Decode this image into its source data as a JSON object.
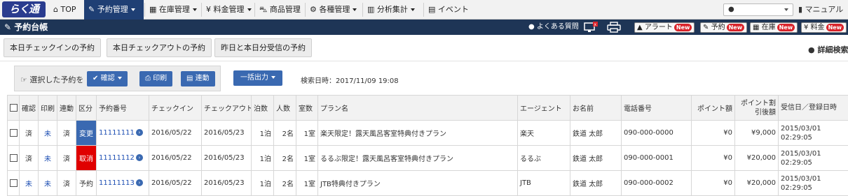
{
  "logo": "らく通",
  "nav": {
    "items": [
      {
        "icon": "home-icon",
        "label": "TOP"
      },
      {
        "icon": "edit-icon",
        "label": "予約管理"
      },
      {
        "icon": "grid-icon",
        "label": "在庫管理"
      },
      {
        "icon": "yen-icon",
        "label": "料金管理"
      },
      {
        "icon": "car-icon",
        "label": "商品管理"
      },
      {
        "icon": "gear-icon",
        "label": "各種管理"
      },
      {
        "icon": "chart-icon",
        "label": "分析集計"
      },
      {
        "icon": "calendar-icon",
        "label": "イベント"
      }
    ],
    "manual": "マニュアル"
  },
  "titlebar": {
    "title": "予約台帳",
    "faq": "よくある質問",
    "new_badge": "New",
    "alert": "アラート",
    "reserve": "予約",
    "stock": "在庫",
    "fee": "料金"
  },
  "tabs": [
    "本日チェックインの予約",
    "本日チェックアウトの予約",
    "昨日と本日分受信の予約"
  ],
  "detail_search": "詳細検索",
  "actions": {
    "selected_label": "選択した予約を",
    "confirm": "確認",
    "print": "印刷",
    "link": "連動",
    "bulk_export": "一括出力",
    "search_time": "検索日時：2017/11/09 19:08"
  },
  "table": {
    "headers": {
      "confirm": "確認",
      "print": "印刷",
      "link": "連動",
      "kubun": "区分",
      "number": "予約番号",
      "checkin": "チェックイン",
      "checkout": "チェックアウト",
      "nights": "泊数",
      "people": "人数",
      "rooms": "室数",
      "plan": "プラン名",
      "agent": "エージェント",
      "name": "お名前",
      "phone": "電話番号",
      "points": "ポイント額",
      "after_points": "ポイント割引後額",
      "received": "受信日／登録日時"
    },
    "rows": [
      {
        "confirm": "済",
        "print": "未",
        "link": "済",
        "kubun": "変更",
        "number": "11111111",
        "checkin": "2016/05/22",
        "checkout": "2016/05/23",
        "nights": "1泊",
        "people": "2名",
        "rooms": "1室",
        "plan": "楽天限定！露天風呂客室特典付きプラン",
        "agent": "楽天",
        "name": "鉄道 太郎",
        "phone": "090-000-0000",
        "points": "¥0",
        "after_points": "¥9,000",
        "received_date": "2015/03/01",
        "received_time": "02:29:05"
      },
      {
        "confirm": "済",
        "print": "未",
        "link": "済",
        "kubun": "取消",
        "number": "11111112",
        "checkin": "2016/05/22",
        "checkout": "2016/05/23",
        "nights": "1泊",
        "people": "2名",
        "rooms": "1室",
        "plan": "るるぶ限定！露天風呂客室特典付きプラン",
        "agent": "るるぶ",
        "name": "鉄道 太郎",
        "phone": "090-000-0001",
        "points": "¥0",
        "after_points": "¥20,000",
        "received_date": "2015/03/01",
        "received_time": "02:29:05"
      },
      {
        "confirm": "未",
        "print": "未",
        "link": "済",
        "kubun": "予約",
        "number": "11111113",
        "checkin": "2016/05/22",
        "checkout": "2016/05/23",
        "nights": "1泊",
        "people": "2名",
        "rooms": "1室",
        "plan": "JTB特典付きプラン",
        "agent": "JTB",
        "name": "鉄道 太郎",
        "phone": "090-000-0002",
        "points": "¥0",
        "after_points": "¥20,000",
        "received_date": "2015/03/01",
        "received_time": "02:29:05"
      }
    ]
  },
  "colors": {
    "nav_active": "#1f3f74",
    "titlebar": "#1e3556",
    "button": "#3a69b1",
    "cancel": "#e00000",
    "new_badge": "#d9232a"
  }
}
